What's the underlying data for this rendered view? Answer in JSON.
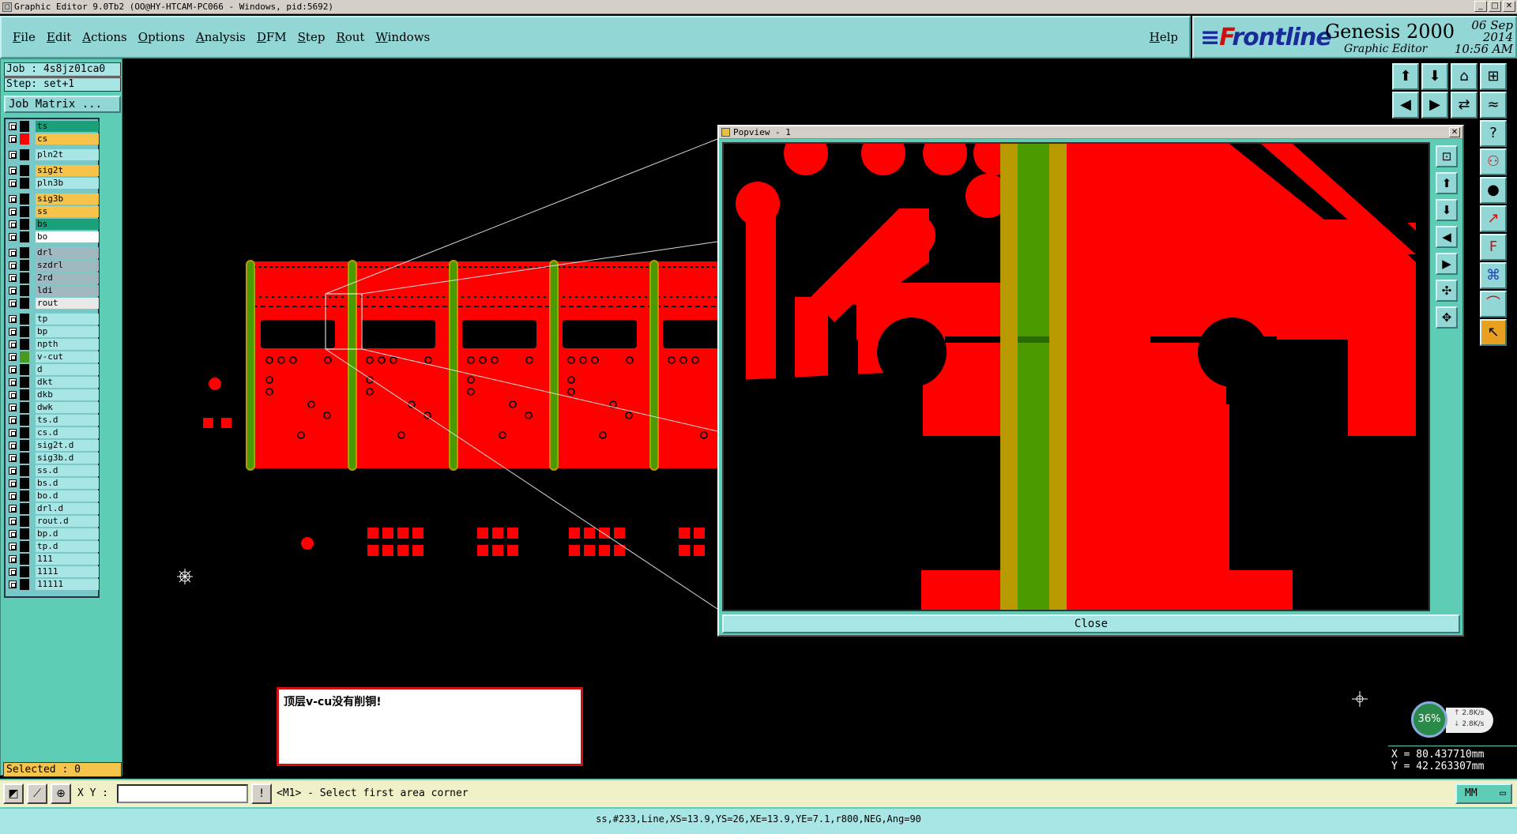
{
  "window": {
    "title": "Graphic Editor 9.0Tb2 (OO@HY-HTCAM-PC066 - Windows, pid:5692)"
  },
  "menu": {
    "items": [
      "File",
      "Edit",
      "Actions",
      "Options",
      "Analysis",
      "DFM",
      "Step",
      "Rout",
      "Windows"
    ],
    "help": "Help"
  },
  "brand": {
    "logo_prefix": "F",
    "logo_rest": "rontline",
    "product": "Genesis 2000",
    "subtitle": "Graphic Editor",
    "date": "06 Sep 2014",
    "time": "10:56 AM"
  },
  "left": {
    "job": "Job : 4s8jz01ca0",
    "step": "Step: set+1",
    "job_matrix": "Job Matrix ...",
    "selected": "Selected : 0"
  },
  "layers": [
    {
      "name": "ts",
      "color": "#1aa07a",
      "swatch": "#000"
    },
    {
      "name": "cs",
      "color": "#f6c44a",
      "swatch": "#ff0000"
    },
    {
      "name": "pln2t",
      "color": "#a8e6e6",
      "swatch": "#000"
    },
    {
      "name": "sig2t",
      "color": "#f6c44a",
      "swatch": "#000"
    },
    {
      "name": "pln3b",
      "color": "#a8e6e6",
      "swatch": "#000"
    },
    {
      "name": "sig3b",
      "color": "#f6c44a",
      "swatch": "#000"
    },
    {
      "name": "ss",
      "color": "#f6c44a",
      "swatch": "#000"
    },
    {
      "name": "bs",
      "color": "#1aa07a",
      "swatch": "#000"
    },
    {
      "name": "bo",
      "color": "#ffffff",
      "swatch": "#000"
    },
    {
      "name": "drl",
      "color": "#a0b8c0",
      "swatch": "#000"
    },
    {
      "name": "szdrl",
      "color": "#a0b8c0",
      "swatch": "#000"
    },
    {
      "name": "2rd",
      "color": "#a0b8c0",
      "swatch": "#000"
    },
    {
      "name": "ldi",
      "color": "#a0b8c0",
      "swatch": "#000"
    },
    {
      "name": "rout",
      "color": "#e8e8e8",
      "swatch": "#000"
    },
    {
      "name": "tp",
      "color": "#a8e6e6",
      "swatch": "#000"
    },
    {
      "name": "bp",
      "color": "#a8e6e6",
      "swatch": "#000"
    },
    {
      "name": "npth",
      "color": "#a8e6e6",
      "swatch": "#000"
    },
    {
      "name": "v-cut",
      "color": "#a8e6e6",
      "swatch": "#4a9a20"
    },
    {
      "name": "d",
      "color": "#a8e6e6",
      "swatch": "#000"
    },
    {
      "name": "dkt",
      "color": "#a8e6e6",
      "swatch": "#000"
    },
    {
      "name": "dkb",
      "color": "#a8e6e6",
      "swatch": "#000"
    },
    {
      "name": "dwk",
      "color": "#a8e6e6",
      "swatch": "#000"
    },
    {
      "name": "ts.d",
      "color": "#a8e6e6",
      "swatch": "#000"
    },
    {
      "name": "cs.d",
      "color": "#a8e6e6",
      "swatch": "#000"
    },
    {
      "name": "sig2t.d",
      "color": "#a8e6e6",
      "swatch": "#000"
    },
    {
      "name": "sig3b.d",
      "color": "#a8e6e6",
      "swatch": "#000"
    },
    {
      "name": "ss.d",
      "color": "#a8e6e6",
      "swatch": "#000"
    },
    {
      "name": "bs.d",
      "color": "#a8e6e6",
      "swatch": "#000"
    },
    {
      "name": "bo.d",
      "color": "#a8e6e6",
      "swatch": "#000"
    },
    {
      "name": "drl.d",
      "color": "#a8e6e6",
      "swatch": "#000"
    },
    {
      "name": "rout.d",
      "color": "#a8e6e6",
      "swatch": "#000"
    },
    {
      "name": "bp.d",
      "color": "#a8e6e6",
      "swatch": "#000"
    },
    {
      "name": "tp.d",
      "color": "#a8e6e6",
      "swatch": "#000"
    },
    {
      "name": "111",
      "color": "#a8e6e6",
      "swatch": "#000"
    },
    {
      "name": "1111",
      "color": "#a8e6e6",
      "swatch": "#000"
    },
    {
      "name": "11111",
      "color": "#a8e6e6",
      "swatch": "#000"
    }
  ],
  "popview": {
    "title": "Popview - 1",
    "close_label": "Close"
  },
  "message": "顶层v-cu没有削铜!",
  "network": {
    "percent": "36%",
    "up": "2.8K/s",
    "down": "2.8K/s"
  },
  "coords": {
    "x": "X = 80.437710mm",
    "y": "Y = 42.263307mm"
  },
  "command": {
    "xy_label": "X Y :",
    "xy_value": "",
    "prompt": "<M1> - Select first area corner",
    "units": "MM"
  },
  "status": "ss,#233,Line,XS=13.9,YS=26,XE=13.9,YE=7.1,r800,NEG,Ang=90",
  "colors": {
    "copper": "#ff0000",
    "vcut": "#4a9a00",
    "vcut_edge": "#b89a00",
    "panel": "#5fcdb5",
    "menu": "#92d6d6"
  }
}
